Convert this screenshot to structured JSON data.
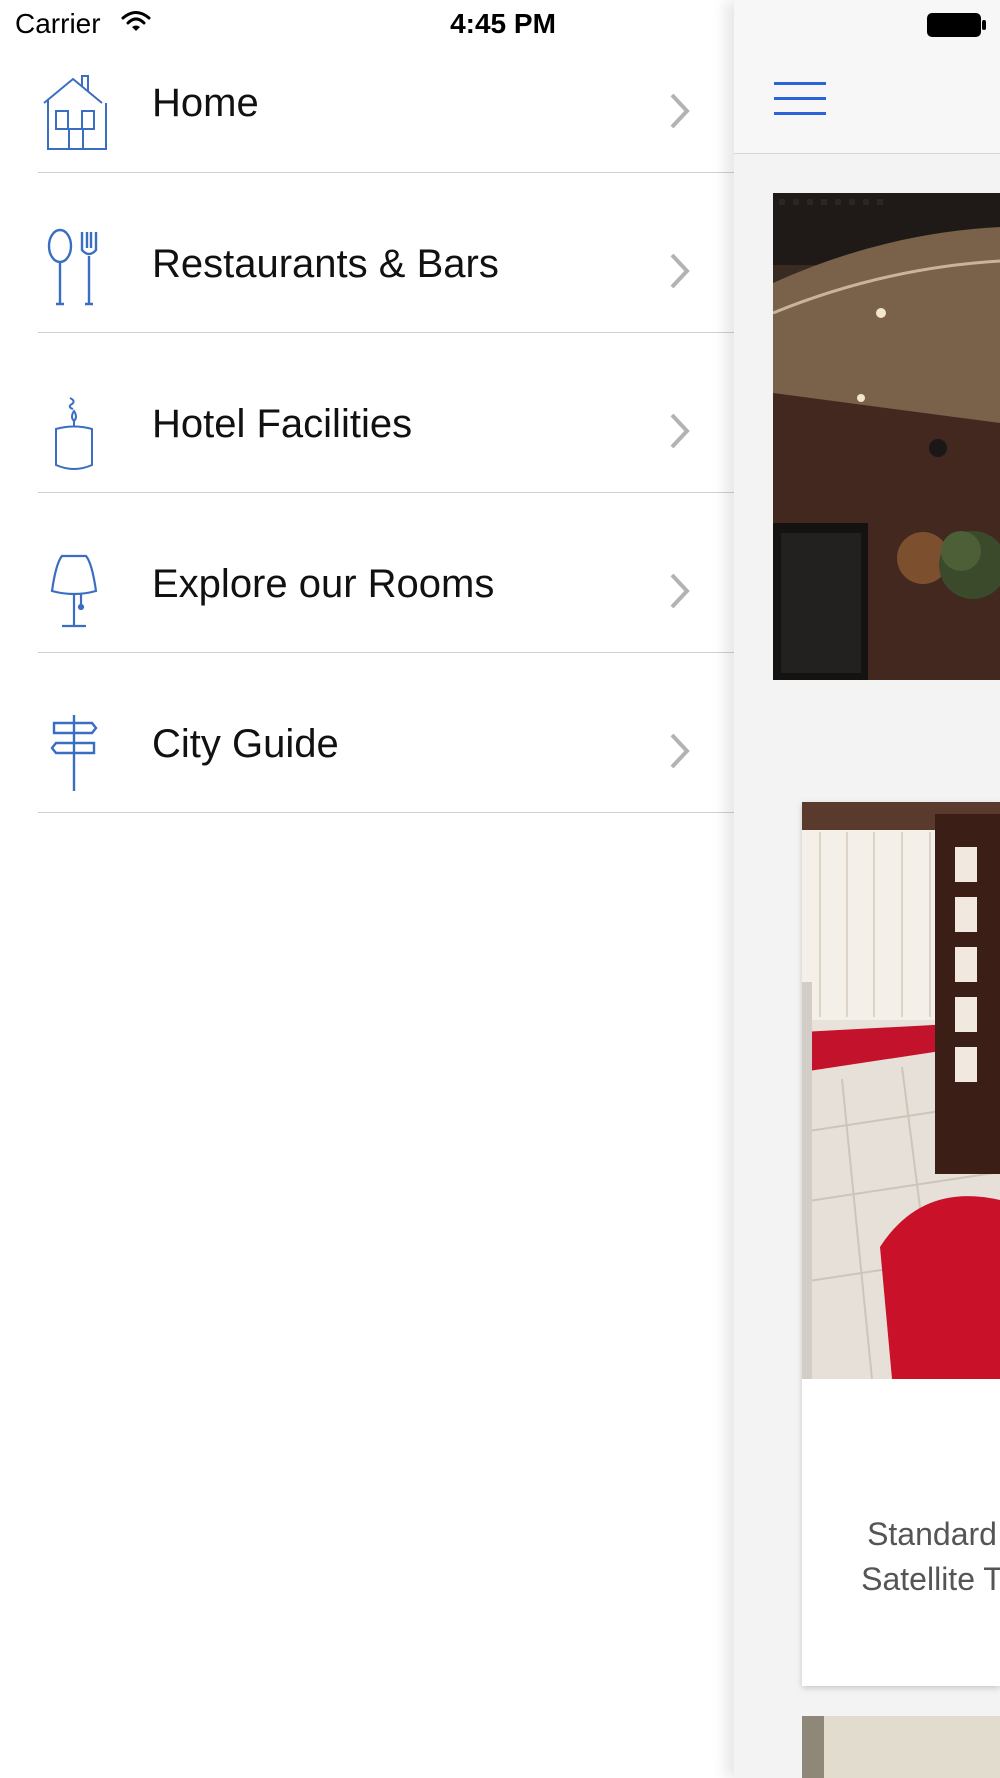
{
  "status_bar": {
    "carrier": "Carrier",
    "time": "4:45 PM"
  },
  "menu": {
    "items": [
      {
        "label": "Home",
        "icon": "house-icon"
      },
      {
        "label": "Restaurants & Bars",
        "icon": "spoon-fork-icon"
      },
      {
        "label": "Hotel Facilities",
        "icon": "candle-icon"
      },
      {
        "label": "Explore our Rooms",
        "icon": "lamp-icon"
      },
      {
        "label": "City Guide",
        "icon": "signpost-icon"
      }
    ]
  },
  "main": {
    "menu_button_icon": "hamburger-icon",
    "card": {
      "text_line1": "Standard",
      "text_line2": "Satellite T"
    }
  },
  "colors": {
    "icon_blue": "#3a6ec2",
    "accent_blue": "#2b63d9",
    "divider": "#cfcfcf",
    "chevron": "#b3b3b3"
  }
}
